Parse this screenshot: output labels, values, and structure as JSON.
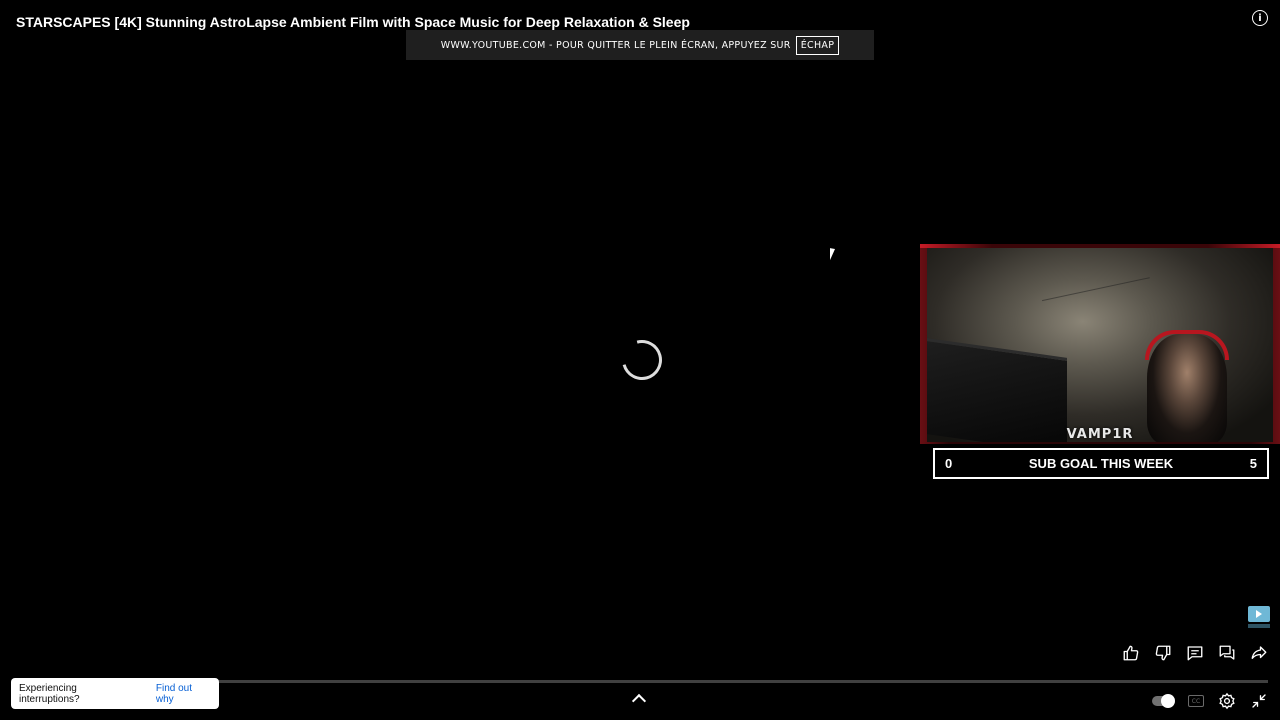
{
  "video": {
    "title": "STARSCAPES [4K] Stunning AstroLapse Ambient Film with Space Music for Deep Relaxation & Sleep"
  },
  "fullscreen_notice": {
    "text": "WWW.YOUTUBE.COM - POUR QUITTER LE PLEIN ÉCRAN, APPUYEZ SUR",
    "key": "ÉCHAP"
  },
  "overlay": {
    "streamer_name": "VAMP1R",
    "sub_goal": {
      "current": "0",
      "label": "SUB GOAL THIS WEEK",
      "target": "5"
    }
  },
  "toast": {
    "message": "Experiencing interruptions?",
    "link": "Find out why"
  },
  "icons": {
    "info": "info-icon",
    "like": "thumbs-up-icon",
    "dislike": "thumbs-down-icon",
    "comments": "comment-icon",
    "live_chat": "chat-bubbles-icon",
    "share": "share-icon",
    "chevron": "chevron-up-icon",
    "autoplay": "autoplay-toggle-icon",
    "captions": "cc-icon",
    "settings": "gear-icon",
    "exit_fullscreen": "exit-fullscreen-icon"
  },
  "captions_label": "CC",
  "colors": {
    "background": "#000000",
    "overlay_accent": "#c61b26",
    "link": "#065fd4"
  }
}
